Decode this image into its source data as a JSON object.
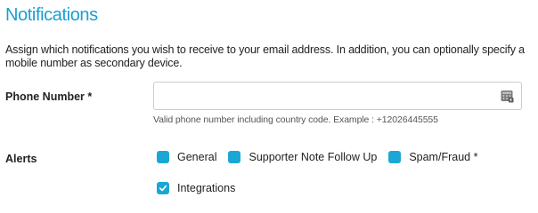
{
  "page": {
    "title": "Notifications",
    "description": "Assign which notifications you wish to receive to your email address. In addition, you can optionally specify a mobile number as secondary device."
  },
  "phone": {
    "label": "Phone Number *",
    "value": "",
    "placeholder": "",
    "hint": "Valid phone number including country code. Example : +12026445555",
    "icon": "phone-keypad-icon"
  },
  "alerts": {
    "label": "Alerts",
    "options": [
      {
        "label": "General",
        "checked": false
      },
      {
        "label": "Supporter Note Follow Up",
        "checked": false
      },
      {
        "label": "Spam/Fraud *",
        "checked": false
      },
      {
        "label": "Integrations",
        "checked": true
      }
    ]
  },
  "colors": {
    "title": "#1a9fd2",
    "checkbox": "#1aa7d6"
  }
}
